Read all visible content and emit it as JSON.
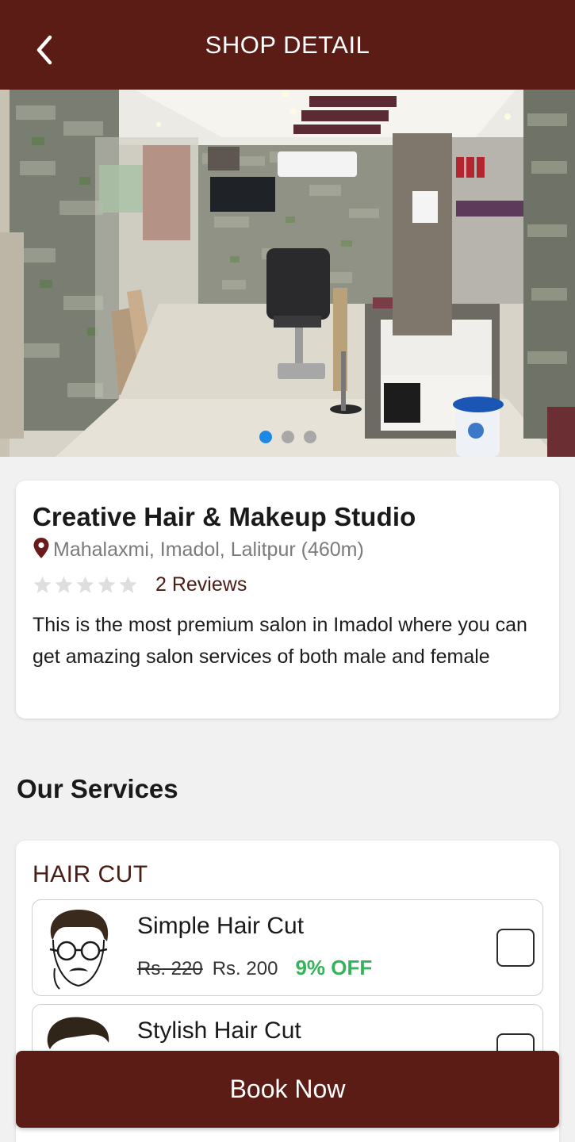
{
  "header": {
    "title": "SHOP DETAIL",
    "back_icon": "chevron-left-icon"
  },
  "gallery": {
    "image_subject": "salon interior photo",
    "slide_count": 3,
    "active_slide": 0
  },
  "shop": {
    "name": "Creative Hair & Makeup Studio",
    "location": "Mahalaxmi, Imadol, Lalitpur (460m)",
    "rating": 0,
    "max_rating": 5,
    "reviews": "2 Reviews",
    "description": "This is the most premium salon in Imadol where you can get amazing salon services of both male and female"
  },
  "services": {
    "section_title": "Our Services",
    "categories": [
      {
        "name": "HAIR CUT",
        "items": [
          {
            "name": "Simple Hair Cut",
            "old_price": "Rs. 220",
            "new_price": "Rs. 200",
            "discount": "9% OFF",
            "checked": false
          },
          {
            "name": "Stylish Hair Cut",
            "checked": false
          }
        ]
      }
    ]
  },
  "cta": {
    "label": "Book Now"
  },
  "colors": {
    "primary": "#5a1c15",
    "discount": "#35b35b",
    "background": "#f1f1f1",
    "active_dot": "#1e88e5"
  }
}
